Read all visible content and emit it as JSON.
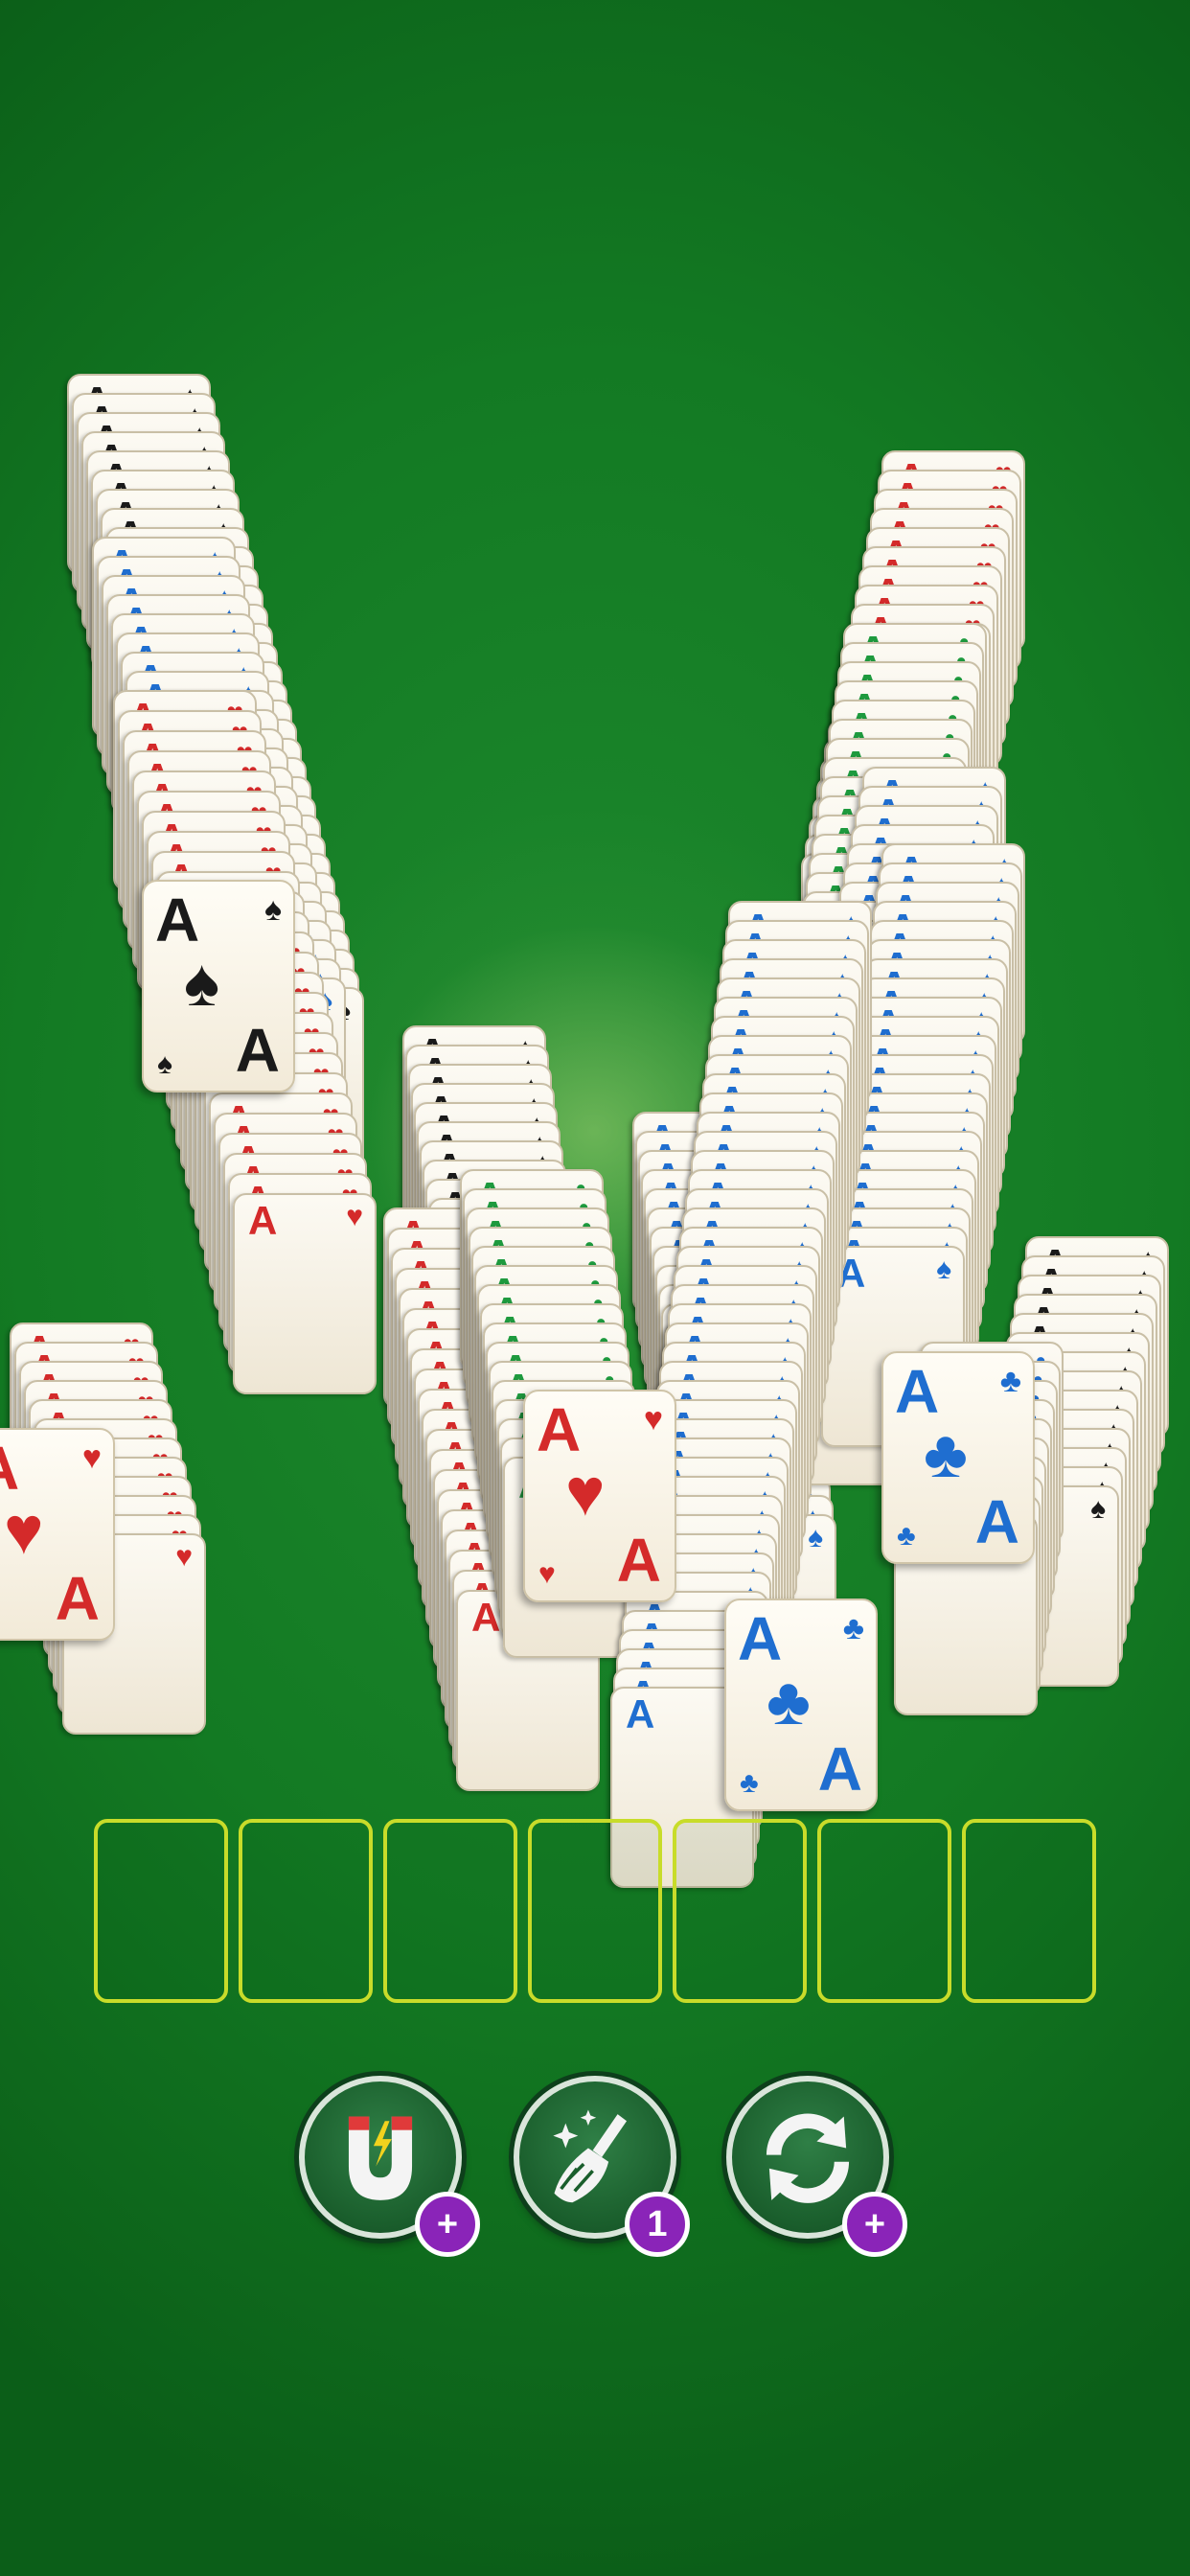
{
  "colors": {
    "felt": "#137a23",
    "slot_border": "#c8dc2a",
    "black_suit": "#1a1a1a",
    "red_suit": "#d42a2a",
    "blue_suit": "#1f6ed0",
    "green_suit": "#1e9a3e",
    "badge": "#8a24b8"
  },
  "stacks": [
    {
      "suit": "♠",
      "color": "black"
    },
    {
      "suit": "♠",
      "color": "blue"
    },
    {
      "suit": "♥",
      "color": "red"
    },
    {
      "suit": "♥",
      "color": "red"
    },
    {
      "suit": "♠",
      "color": "black"
    },
    {
      "suit": "♥",
      "color": "red"
    },
    {
      "suit": "♣",
      "color": "green"
    },
    {
      "suit": "♠",
      "color": "blue"
    },
    {
      "suit": "♥",
      "color": "red"
    },
    {
      "suit": "♣",
      "color": "green"
    },
    {
      "suit": "♠",
      "color": "blue"
    },
    {
      "suit": "♠",
      "color": "blue"
    },
    {
      "suit": "♠",
      "color": "blue"
    },
    {
      "suit": "♠",
      "color": "black"
    },
    {
      "suit": "♣",
      "color": "blue"
    }
  ],
  "face_cards": [
    {
      "rank": "A",
      "suit": "♠",
      "color": "black"
    },
    {
      "rank": "A",
      "suit": "♥",
      "color": "red"
    },
    {
      "rank": "A",
      "suit": "♥",
      "color": "red"
    },
    {
      "rank": "A",
      "suit": "♣",
      "color": "blue"
    },
    {
      "rank": "A",
      "suit": "♣",
      "color": "blue"
    }
  ],
  "slots_count": 7,
  "powerups": [
    {
      "name": "magnet",
      "icon": "magnet-icon",
      "badge": "+"
    },
    {
      "name": "broom",
      "icon": "broom-icon",
      "badge": "1"
    },
    {
      "name": "shuffle",
      "icon": "shuffle-icon",
      "badge": "+"
    }
  ]
}
